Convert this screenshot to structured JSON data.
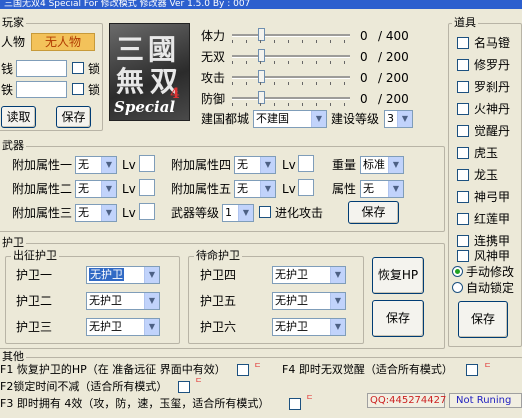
{
  "window": {
    "title": "三国无双4 Special For 修改模式 修改器 Ver 1.5.0 By : 007"
  },
  "player": {
    "legend": "玩家",
    "char_label": "人物",
    "char_value": "无人物",
    "money_label": "钱",
    "iron_label": "铁",
    "lock_label": "锁",
    "read_button": "读取",
    "save_button": "保存"
  },
  "logo": {
    "chars": "三國無双",
    "sub": "Special",
    "num": "4"
  },
  "stats": [
    {
      "label": "体力",
      "value": "0",
      "max": "/ 400"
    },
    {
      "label": "无双",
      "value": "0",
      "max": "/ 200"
    },
    {
      "label": "攻击",
      "value": "0",
      "max": "/ 200"
    },
    {
      "label": "防御",
      "value": "0",
      "max": "/ 200"
    }
  ],
  "city": {
    "label": "建国都城",
    "value": "不建国",
    "level_label": "建设等级",
    "level_value": "3"
  },
  "items": {
    "legend": "道具",
    "list": [
      "名马镫",
      "修罗丹",
      "罗刹丹",
      "火神丹",
      "觉醒丹",
      "虎玉",
      "龙玉",
      "神弓甲",
      "红莲甲",
      "连携甲",
      "风神甲"
    ],
    "mode_manual": "手动修改",
    "mode_auto": "自动锁定",
    "save_button": "保存"
  },
  "weapon": {
    "legend": "武器",
    "attrs": [
      {
        "label": "附加属性一",
        "value": "无"
      },
      {
        "label": "附加属性二",
        "value": "无"
      },
      {
        "label": "附加属性三",
        "value": "无"
      },
      {
        "label": "附加属性四",
        "value": "无"
      },
      {
        "label": "附加属性五",
        "value": "无"
      }
    ],
    "lv_label": "Lv",
    "weight_label": "重量",
    "weight_value": "标准",
    "element_label": "属性",
    "element_value": "无",
    "level_label": "武器等级",
    "level_value": "1",
    "evolve_label": "进化攻击",
    "save_button": "保存"
  },
  "guards": {
    "legend": "护卫",
    "expedition_legend": "出征护卫",
    "standby_legend": "待命护卫",
    "expedition": [
      {
        "label": "护卫一",
        "value": "无护卫"
      },
      {
        "label": "护卫二",
        "value": "无护卫"
      },
      {
        "label": "护卫三",
        "value": "无护卫"
      }
    ],
    "standby": [
      {
        "label": "护卫四",
        "value": "无护卫"
      },
      {
        "label": "护卫五",
        "value": "无护卫"
      },
      {
        "label": "护卫六",
        "value": "无护卫"
      }
    ],
    "restore_hp_button": "恢复HP",
    "save_button": "保存"
  },
  "other": {
    "legend": "其他",
    "f1": "F1 恢复护卫的HP（在 准备远征 界面中有效）",
    "f4": "F4 即时无双觉醒（适合所有模式）",
    "f2": "F2锁定时间不减（适合所有模式）",
    "f3": "F3 即时拥有 4效（攻，防，速，玉玺，适合所有模式）",
    "hotkey_mark": "ㄷ",
    "qq": "QQ:445274427",
    "status": "Not Runing"
  },
  "colors": {
    "titlebar": "#2c5fce",
    "qq_text": "#cc2222",
    "status_text": "#2020c0",
    "char_value_bg": "#f3c25a"
  }
}
